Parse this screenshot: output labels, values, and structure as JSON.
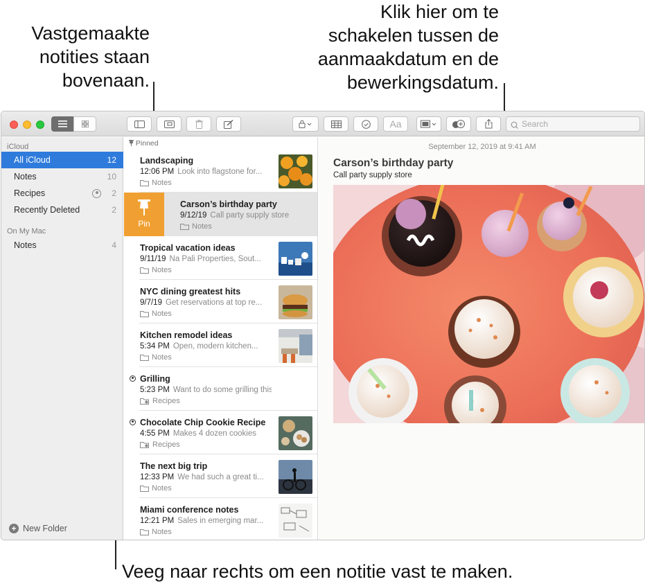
{
  "callouts": {
    "pinned_top": [
      "Vastgemaakte",
      "notities staan",
      "bovenaan."
    ],
    "toggle_date": [
      "Klik hier om te",
      "schakelen tussen de",
      "aanmaakdatum en de",
      "bewerkingsdatum."
    ],
    "swipe_pin": "Veeg naar rechts om een notitie vast te maken."
  },
  "toolbar": {
    "search_placeholder": "Search",
    "icons": [
      "list-view-icon",
      "gallery-view-icon",
      "sidebar-toggle-icon",
      "attachments-icon",
      "trash-icon",
      "compose-icon",
      "lock-icon",
      "table-icon",
      "checklist-icon",
      "format-icon",
      "media-icon",
      "collaborate-icon",
      "share-icon",
      "search-icon"
    ],
    "format_label": "Aa"
  },
  "sidebar": {
    "sections": [
      {
        "label": "iCloud",
        "items": [
          {
            "label": "All iCloud",
            "count": "12",
            "selected": true
          },
          {
            "label": "Notes",
            "count": "10"
          },
          {
            "label": "Recipes",
            "count": "2",
            "shared": true
          },
          {
            "label": "Recently Deleted",
            "count": "2"
          }
        ]
      },
      {
        "label": "On My Mac",
        "items": [
          {
            "label": "Notes",
            "count": "4"
          }
        ]
      }
    ],
    "new_folder": "New Folder"
  },
  "list": {
    "pinned_header": "Pinned",
    "pin_action": "Pin",
    "notes": [
      {
        "title": "Landscaping",
        "time": "12:06 PM",
        "preview": "Look into flagstone for...",
        "folder": "Notes",
        "thumb": "flowers"
      },
      {
        "title": "Carson’s birthday party",
        "time": "9/12/19",
        "preview": "Call party supply store",
        "folder": "Notes",
        "swiped": true
      },
      {
        "title": "Tropical vacation ideas",
        "time": "9/11/19",
        "preview": "Na Pali Properties, Sout...",
        "folder": "Notes",
        "thumb": "coast"
      },
      {
        "title": "NYC dining greatest hits",
        "time": "9/7/19",
        "preview": "Get reservations at top re...",
        "folder": "Notes",
        "thumb": "burger"
      },
      {
        "title": "Kitchen remodel ideas",
        "time": "5:34 PM",
        "preview": "Open, modern kitchen...",
        "folder": "Notes",
        "thumb": "kitchen"
      },
      {
        "title": "Grilling",
        "time": "5:23 PM",
        "preview": "Want to do some grilling this wee...",
        "folder": "Recipes",
        "shared": true
      },
      {
        "title": "Chocolate Chip Cookie Recipe",
        "time": "4:55 PM",
        "preview": "Makes 4 dozen cookies",
        "folder": "Recipes",
        "shared": true,
        "thumb": "cookies"
      },
      {
        "title": "The next big trip",
        "time": "12:33 PM",
        "preview": "We had such a great ti...",
        "folder": "Notes",
        "thumb": "bike"
      },
      {
        "title": "Miami conference notes",
        "time": "12:21 PM",
        "preview": "Sales in emerging mar...",
        "folder": "Notes",
        "thumb": "sketch"
      }
    ]
  },
  "note_view": {
    "date": "September 12, 2019 at 9:41 AM",
    "title": "Carson’s birthday party",
    "body": "Call party supply store",
    "image": "cupcakes-photo"
  },
  "colors": {
    "selection": "#2e7bdc",
    "pin": "#f0a032",
    "sidebar_bg": "#eeeeee"
  }
}
